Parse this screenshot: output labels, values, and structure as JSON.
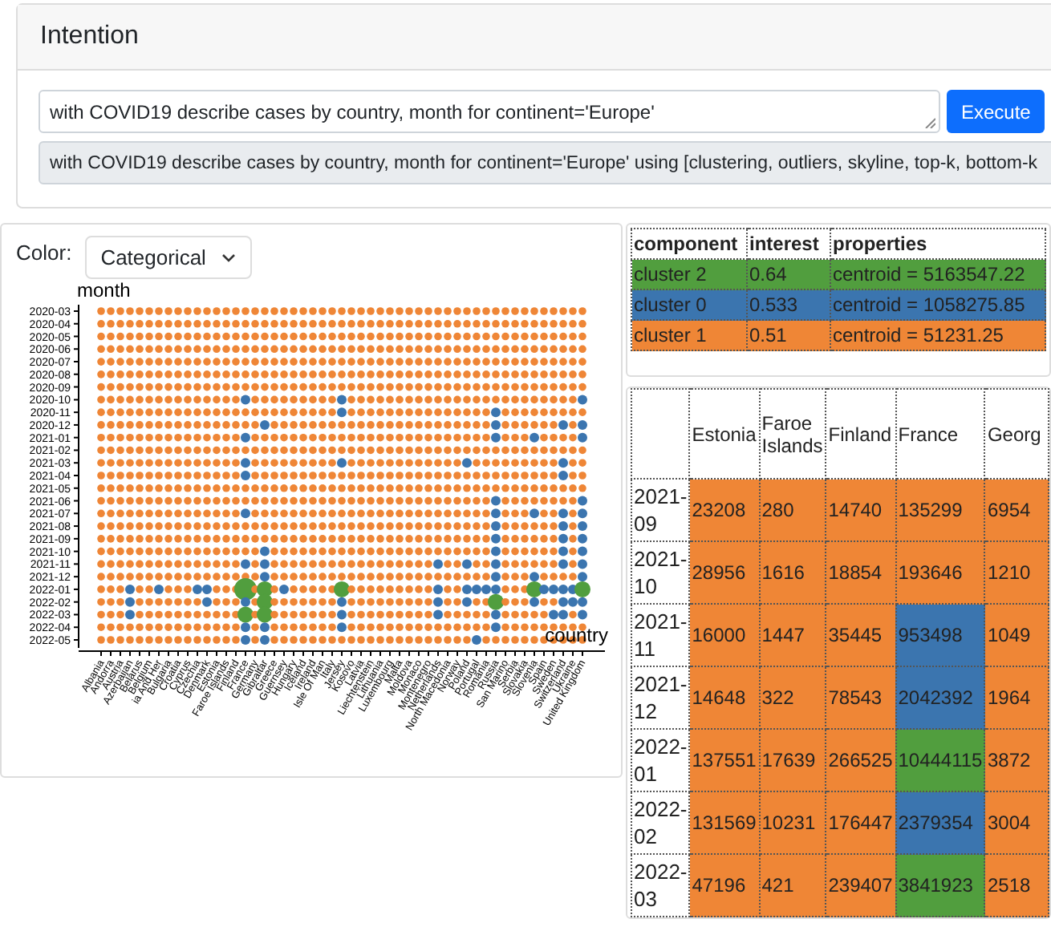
{
  "header": {
    "title": "Intention"
  },
  "query": {
    "value": "with COVID19 describe cases by country, month for continent='Europe'",
    "button": "Execute"
  },
  "expanded_query": "with COVID19 describe cases by country, month for continent='Europe' using [clustering, outliers, skyline, top-k, bottom-k",
  "chart_panel": {
    "color_label": "Color:",
    "color_select": "Categorical",
    "y_title": "month",
    "x_title": "country",
    "months": [
      "2020-03",
      "2020-04",
      "2020-05",
      "2020-06",
      "2020-07",
      "2020-08",
      "2020-09",
      "2020-10",
      "2020-11",
      "2020-12",
      "2021-01",
      "2021-02",
      "2021-03",
      "2021-04",
      "2021-05",
      "2021-06",
      "2021-07",
      "2021-08",
      "2021-09",
      "2021-10",
      "2021-11",
      "2021-12",
      "2022-01",
      "2022-02",
      "2022-03",
      "2022-04",
      "2022-05"
    ],
    "countries": [
      "Albania",
      "Andorra",
      "Austria",
      "Azerbaijan",
      "Belarus",
      "Belgium",
      "ia And Her",
      "Bulgaria",
      "Croatia",
      "Cyprus",
      "Czechia",
      "Denmark",
      "Estonia",
      "Faroe Islands",
      "Finland",
      "France",
      "Germany",
      "Gibraltar",
      "Greece",
      "Guernsey",
      "Hungary",
      "Iceland",
      "Ireland",
      "Isle Of Man",
      "Italy",
      "Jersey",
      "Kosovo",
      "Latvia",
      "Liechtenstein",
      "Lithuania",
      "Luxembourg",
      "Malta",
      "Moldova",
      "Monaco",
      "Montenegro",
      "Netherlands",
      "North Macedonia",
      "Norway",
      "Poland",
      "Portugal",
      "Romania",
      "Russia",
      "San Marino",
      "Serbia",
      "Slovakia",
      "Slovenia",
      "Spain",
      "Sweden",
      "Switzerland",
      "Ukraine",
      "United Kingdom"
    ]
  },
  "summary_table": {
    "columns": [
      "component",
      "interest",
      "properties"
    ],
    "rows": [
      {
        "cells": [
          "cluster 2",
          "0.64",
          "centroid = 5163547.22"
        ],
        "color": "#519e3e"
      },
      {
        "cells": [
          "cluster 0",
          "0.533",
          "centroid = 1058275.85"
        ],
        "color": "#3b75af"
      },
      {
        "cells": [
          "cluster 1",
          "0.51",
          "centroid = 51231.25"
        ],
        "color": "#ef8636"
      }
    ]
  },
  "data_table": {
    "columns": [
      "Estonia",
      "Faroe Islands",
      "Finland",
      "France",
      "Georg"
    ],
    "rows": [
      {
        "month": "2021-09",
        "cells": [
          {
            "text": "23208",
            "color": "#ef8636"
          },
          {
            "text": "280",
            "color": "#ef8636"
          },
          {
            "text": "14740",
            "color": "#ef8636"
          },
          {
            "text": "135299",
            "color": "#ef8636"
          },
          {
            "text": "6954",
            "color": "#ef8636"
          }
        ]
      },
      {
        "month": "2021-10",
        "cells": [
          {
            "text": "28956",
            "color": "#ef8636"
          },
          {
            "text": "1616",
            "color": "#ef8636"
          },
          {
            "text": "18854",
            "color": "#ef8636"
          },
          {
            "text": "193646",
            "color": "#ef8636"
          },
          {
            "text": "1210",
            "color": "#ef8636"
          }
        ]
      },
      {
        "month": "2021-11",
        "cells": [
          {
            "text": "16000",
            "color": "#ef8636"
          },
          {
            "text": "1447",
            "color": "#ef8636"
          },
          {
            "text": "35445",
            "color": "#ef8636"
          },
          {
            "text": "953498",
            "color": "#3b75af"
          },
          {
            "text": "1049",
            "color": "#ef8636"
          }
        ]
      },
      {
        "month": "2021-12",
        "cells": [
          {
            "text": "14648",
            "color": "#ef8636"
          },
          {
            "text": "322",
            "color": "#ef8636"
          },
          {
            "text": "78543",
            "color": "#ef8636"
          },
          {
            "text": "2042392",
            "color": "#3b75af"
          },
          {
            "text": "1964",
            "color": "#ef8636"
          }
        ]
      },
      {
        "month": "2022-01",
        "cells": [
          {
            "text": "137551",
            "color": "#ef8636"
          },
          {
            "text": "17639",
            "color": "#ef8636"
          },
          {
            "text": "266525",
            "color": "#ef8636"
          },
          {
            "text": "10444115",
            "color": "#519e3e"
          },
          {
            "text": "3872",
            "color": "#ef8636"
          }
        ]
      },
      {
        "month": "2022-02",
        "cells": [
          {
            "text": "131569",
            "color": "#ef8636"
          },
          {
            "text": "10231",
            "color": "#ef8636"
          },
          {
            "text": "176447",
            "color": "#ef8636"
          },
          {
            "text": "2379354",
            "color": "#3b75af"
          },
          {
            "text": "3004",
            "color": "#ef8636"
          }
        ]
      },
      {
        "month": "2022-03",
        "cells": [
          {
            "text": "47196",
            "color": "#ef8636"
          },
          {
            "text": "421",
            "color": "#ef8636"
          },
          {
            "text": "239407",
            "color": "#ef8636"
          },
          {
            "text": "3841923",
            "color": "#519e3e"
          },
          {
            "text": "2518",
            "color": "#ef8636"
          }
        ]
      }
    ]
  }
}
